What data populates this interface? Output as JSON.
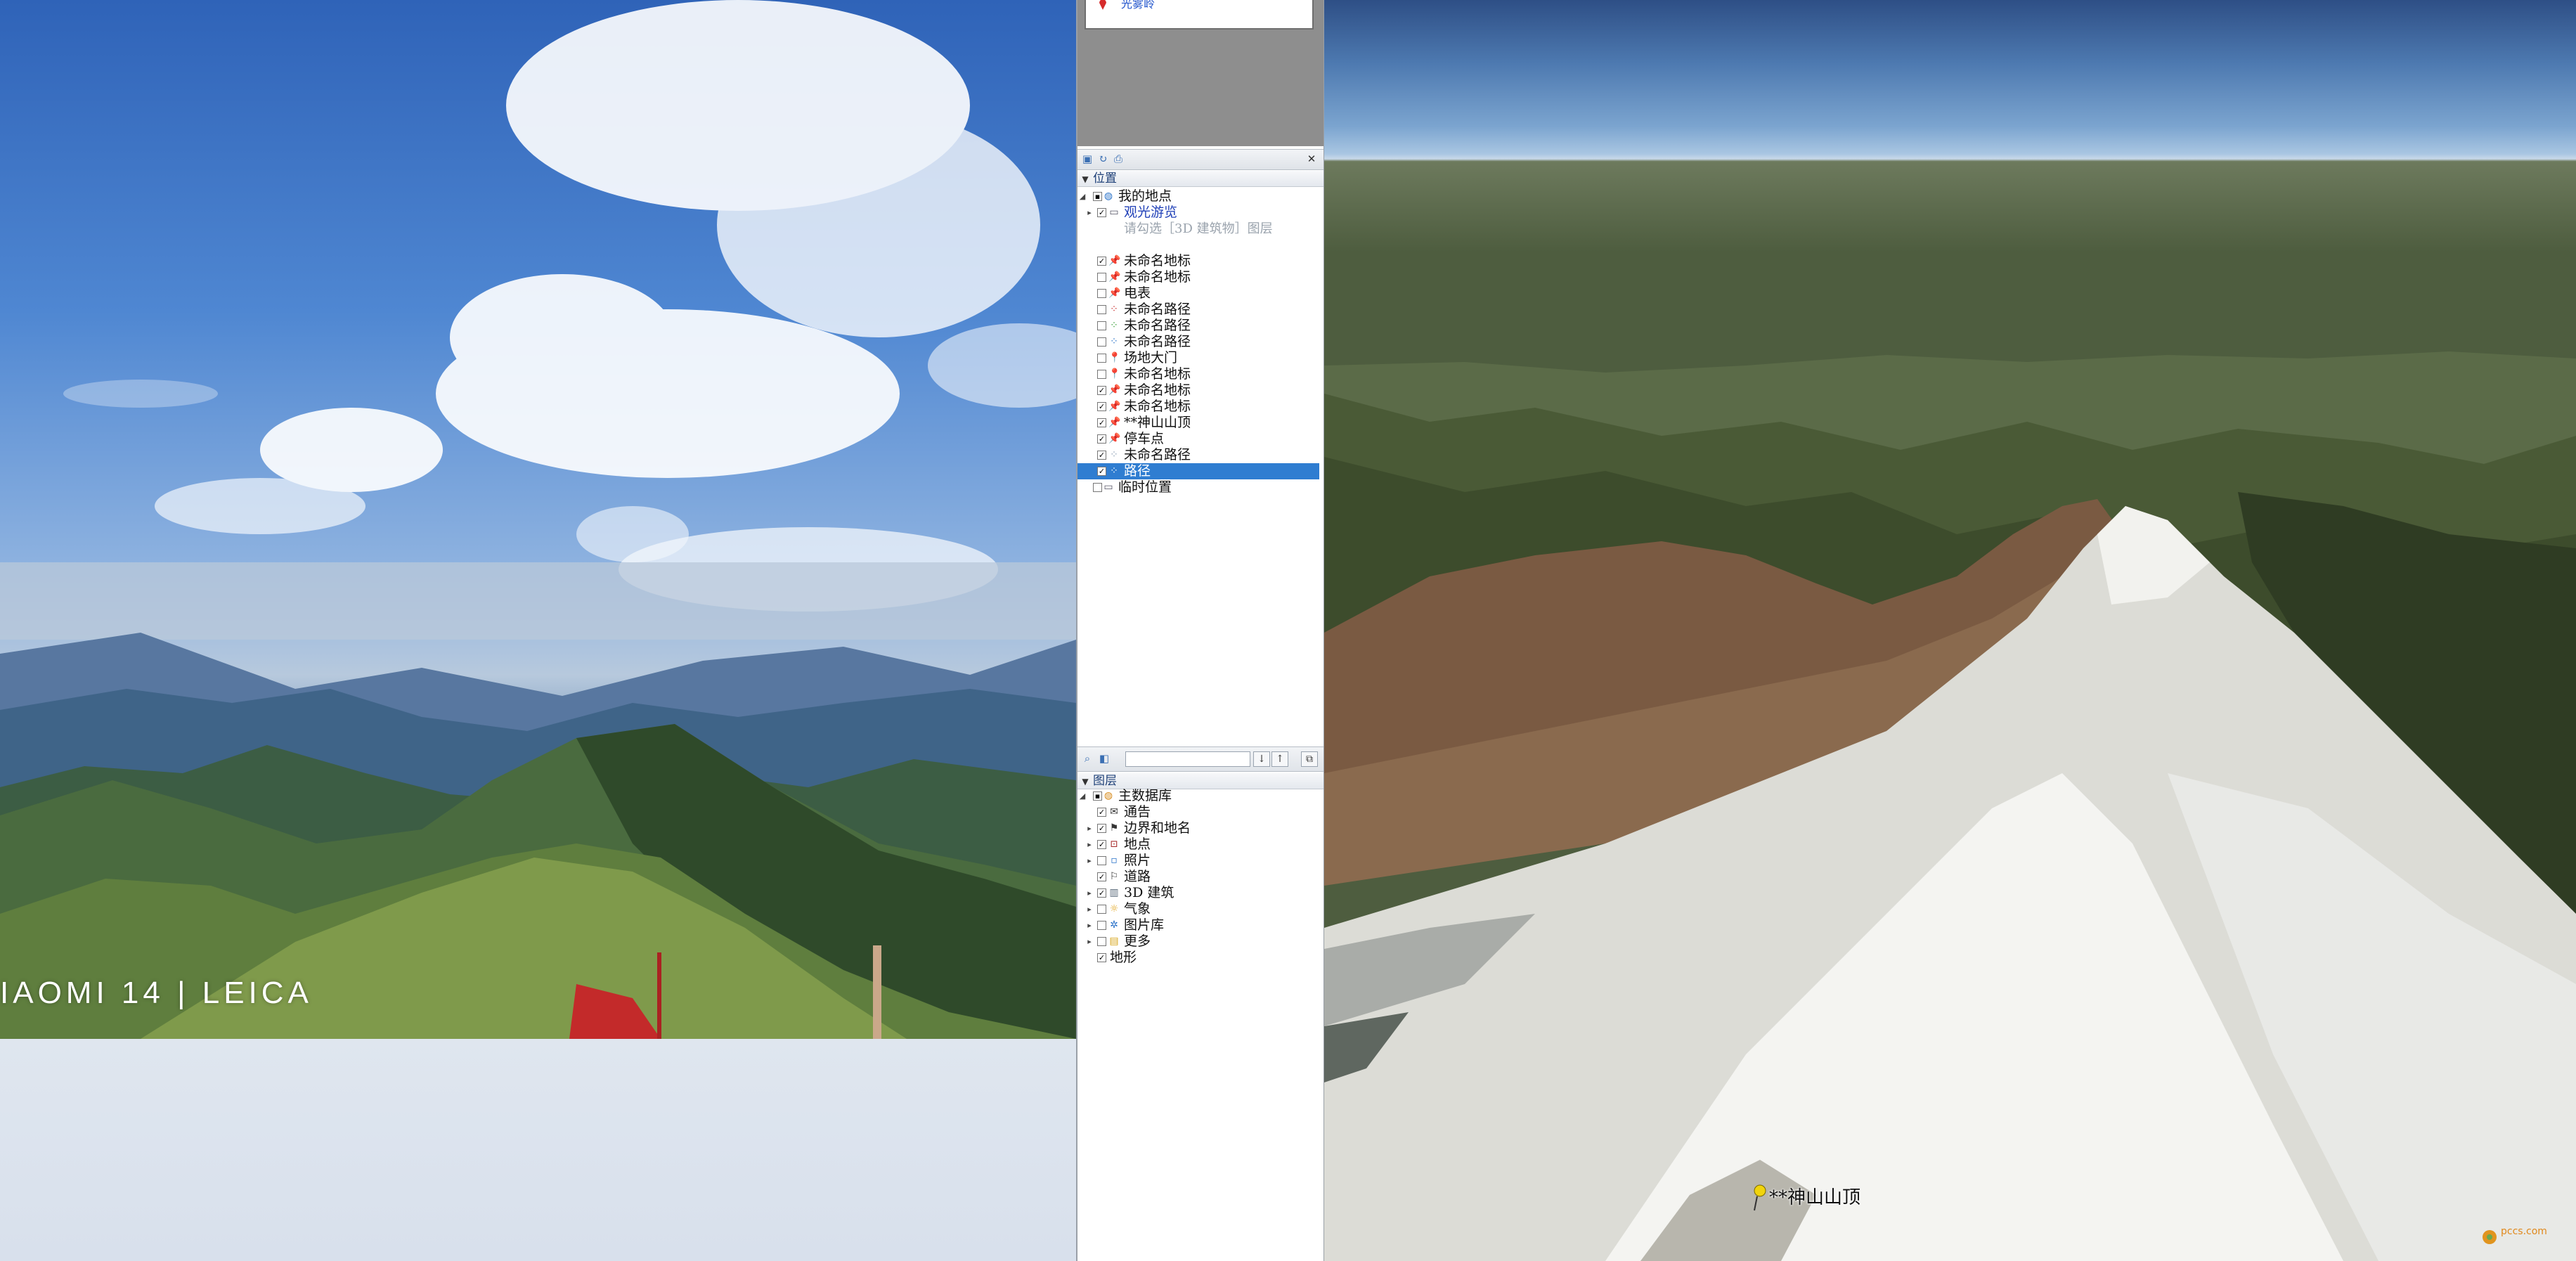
{
  "photo": {
    "caption": "IAOMI 14 | LEICA"
  },
  "search_results": {
    "first_result": "光雾岭"
  },
  "places_panel": {
    "header": "位置",
    "items": [
      {
        "label": "我的地点",
        "icon": "globe-icon",
        "checked": true
      },
      {
        "label": "观光游览",
        "icon": "folder-icon",
        "checked": true
      },
      {
        "label": "请勾选［3D 建筑物］图层",
        "sub": true
      },
      {
        "label": "未命名地标",
        "icon": "pushpin-icon",
        "checked": true
      },
      {
        "label": "未命名地标",
        "icon": "pushpin-icon",
        "checked": false
      },
      {
        "label": "电表",
        "icon": "pushpin-icon",
        "checked": false
      },
      {
        "label": "未命名路径",
        "icon": "path-icon",
        "checked": false
      },
      {
        "label": "未命名路径",
        "icon": "path-icon",
        "checked": false
      },
      {
        "label": "未命名路径",
        "icon": "path-icon",
        "checked": false
      },
      {
        "label": "场地大门",
        "icon": "pushpin-red-icon",
        "checked": false
      },
      {
        "label": "未命名地标",
        "icon": "pushpin-red-icon",
        "checked": false
      },
      {
        "label": "未命名地标",
        "icon": "pushpin-icon",
        "checked": true
      },
      {
        "label": "未命名地标",
        "icon": "pushpin-icon",
        "checked": true
      },
      {
        "label": "**神山山顶",
        "icon": "pushpin-icon",
        "checked": true
      },
      {
        "label": "停车点",
        "icon": "pushpin-icon",
        "checked": true
      },
      {
        "label": "未命名路径",
        "icon": "path-icon",
        "checked": true
      },
      {
        "label": "路径",
        "icon": "path-icon",
        "checked": true,
        "selected": true
      },
      {
        "label": "临时位置",
        "icon": "folder-icon",
        "checked": false
      }
    ]
  },
  "layers_panel": {
    "header": "图层",
    "items": [
      {
        "label": "主数据库",
        "icon": "globe-icon",
        "checked": true
      },
      {
        "label": "通告",
        "icon": "mail-icon",
        "checked": true
      },
      {
        "label": "边界和地名",
        "icon": "flag-icon",
        "checked": true
      },
      {
        "label": "地点",
        "icon": "place-icon",
        "checked": true
      },
      {
        "label": "照片",
        "icon": "photo-icon",
        "checked": false
      },
      {
        "label": "道路",
        "icon": "road-icon",
        "checked": true
      },
      {
        "label": "3D 建筑",
        "icon": "building-icon",
        "checked": true
      },
      {
        "label": "气象",
        "icon": "weather-icon",
        "checked": false
      },
      {
        "label": "图片库",
        "icon": "gallery-icon",
        "checked": false
      },
      {
        "label": "更多",
        "icon": "more-icon",
        "checked": false
      },
      {
        "label": "地形",
        "icon": "terrain-icon",
        "checked": true
      }
    ]
  },
  "earth_view": {
    "placemark_label": "**神山山顶",
    "watermark_text": "pccs.com"
  },
  "colors": {
    "selection": "#2f7dd1",
    "link_blue": "#2242b8",
    "header_text": "#1d3f77"
  }
}
